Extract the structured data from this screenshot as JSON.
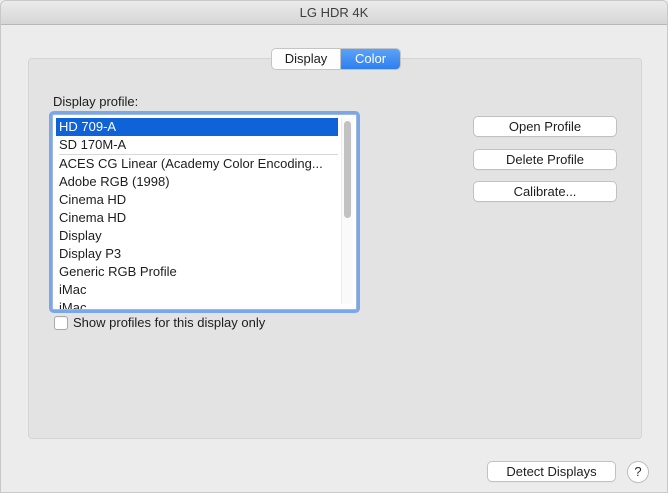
{
  "window": {
    "title": "LG HDR 4K"
  },
  "tabs": [
    {
      "label": "Display",
      "active": false
    },
    {
      "label": "Color",
      "active": true
    }
  ],
  "profile_section": {
    "label": "Display profile:",
    "selected_index": 0,
    "items_top": [
      "HD 709-A",
      "SD 170M-A"
    ],
    "items_rest": [
      "ACES CG Linear (Academy Color Encoding...",
      "Adobe RGB (1998)",
      "Cinema HD",
      "Cinema HD",
      "Display",
      "Display P3",
      "Generic RGB Profile",
      "iMac",
      "iMac"
    ]
  },
  "checkbox": {
    "label": "Show profiles for this display only",
    "checked": false
  },
  "buttons": {
    "open_profile": "Open Profile",
    "delete_profile": "Delete Profile",
    "calibrate": "Calibrate...",
    "detect_displays": "Detect Displays",
    "help": "?"
  },
  "colors": {
    "selection": "#0e63d8",
    "accent_tab": "#2d7ff0",
    "focus_ring": "#7aa7ea"
  }
}
